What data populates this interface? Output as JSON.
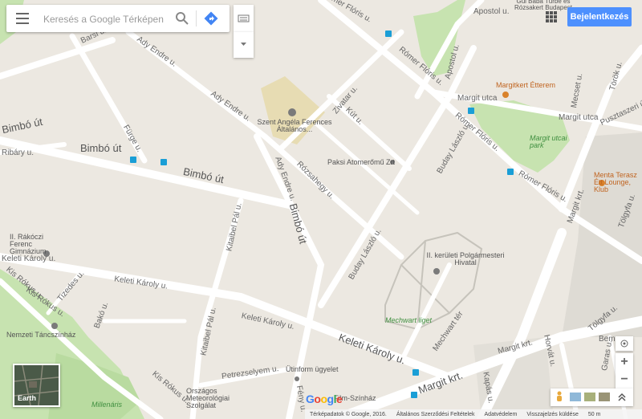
{
  "search": {
    "placeholder": "Keresés a Google Térképen"
  },
  "header": {
    "signin_label": "Bejelentkezés"
  },
  "map": {
    "streets": [
      "Barsi u.",
      "Ady Endre u.",
      "Ady Endre u.",
      "Bimbó út",
      "Bimbó út",
      "Bimbó út",
      "Bimbó út",
      "Ribáry u.",
      "Fürge u.",
      "Ady Endre u.",
      "Zivatar u.",
      "Kút u.",
      "Rózsahegy u.",
      "Rómer Flóris u.",
      "Apostol u.",
      "Apostol u.",
      "Rómer Flóris u.",
      "Margit utca",
      "Margit utca",
      "Mecset u.",
      "Török u.",
      "Rómer Flóris u.",
      "Rómer Flóris u.",
      "Buday László u.",
      "Buday László u.",
      "Margit krt.",
      "Tölgyfa u.",
      "Tölgyfa u.",
      "Pusztaszeri út",
      "Keleti Károly u.",
      "Keleti Károly u.",
      "Keleti Károly u.",
      "Keleti Károly u.",
      "Kitaibel Pál u.",
      "Kitaibel Pál u.",
      "Tizedes u.",
      "Bakó u.",
      "Kis Rókus u.",
      "Kis Rókus u.",
      "Kis Rókus u.",
      "Petrezselyem u.",
      "Mechwart tér",
      "Margit krt.",
      "Margit krt.",
      "Horvát u.",
      "Garas u.",
      "Kapás u.",
      "Bem",
      "Fény u."
    ],
    "pois": [
      "Szent Angéla Ferences Általános...",
      "Paksi Atomerőmű Zrt",
      "Gül Baba Türbe és Rózsakert Budapest",
      "Margitkert Étterem",
      "Margit utcai park",
      "Menta Terasz Étt Lounge, Klub",
      "II. kerületi Polgármesteri Hivatal",
      "II. Rákóczi Ferenc Gimnázium",
      "Nemzeti Táncszínház",
      "Mechwart liget",
      "Ütinform ügyelet",
      "Országos Meteorológiai Szolgálat",
      "Millenáris",
      "Film-Színház"
    ]
  },
  "controls": {
    "earth_label": "Earth",
    "zoom_in": "+",
    "zoom_out": "−"
  },
  "footer": {
    "mapdata": "Térképadatok © Google, 2016.",
    "terms": "Általános Szerződési Feltételek",
    "privacy": "Adatvédelem",
    "feedback": "Visszajelzés küldése",
    "scale": "50 m"
  },
  "colors": {
    "background": "#ece8e1",
    "road": "#ffffff",
    "park": "#c7e3b0",
    "school": "#e7dcb3",
    "building": "#e0ddd6",
    "signin": "#4d90fe",
    "transit": "#1a9ed6"
  }
}
